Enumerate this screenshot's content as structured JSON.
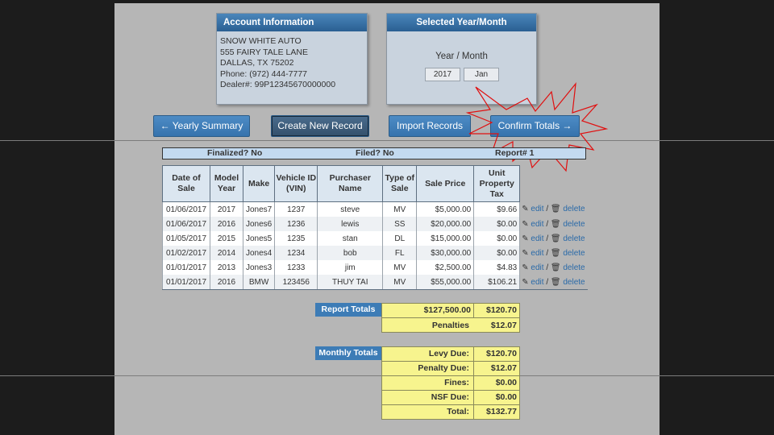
{
  "account_panel": {
    "title": "Account Information",
    "lines": [
      "SNOW WHITE AUTO",
      "555 FAIRY TALE LANE",
      "DALLAS, TX 75202",
      "Phone: (972) 444-7777",
      "Dealer#: 99P12345670000000"
    ]
  },
  "year_month_panel": {
    "title": "Selected Year/Month",
    "label": "Year / Month",
    "year": "2017",
    "month": "Jan"
  },
  "toolbar": {
    "yearly_summary": "← Yearly Summary",
    "create_record": "Create New Record",
    "import_records": "Import Records",
    "confirm_totals": "Confirm Totals →"
  },
  "status": {
    "finalized": "Finalized? No",
    "filed": "Filed? No",
    "report": "Report# 1"
  },
  "table": {
    "headers": [
      "Date of Sale",
      "Model Year",
      "Make",
      "Vehicle ID (VIN)",
      "Purchaser Name",
      "Type of Sale",
      "Sale Price",
      "Unit Property Tax"
    ],
    "action_edit": "edit",
    "action_sep": "/",
    "action_delete": "delete",
    "rows": [
      [
        "01/06/2017",
        "2017",
        "Jones7",
        "1237",
        "steve",
        "MV",
        "$5,000.00",
        "$9.66"
      ],
      [
        "01/06/2017",
        "2016",
        "Jones6",
        "1236",
        "lewis",
        "SS",
        "$20,000.00",
        "$0.00"
      ],
      [
        "01/05/2017",
        "2015",
        "Jones5",
        "1235",
        "stan",
        "DL",
        "$15,000.00",
        "$0.00"
      ],
      [
        "01/02/2017",
        "2014",
        "Jones4",
        "1234",
        "bob",
        "FL",
        "$30,000.00",
        "$0.00"
      ],
      [
        "01/01/2017",
        "2013",
        "Jones3",
        "1233",
        "jim",
        "MV",
        "$2,500.00",
        "$4.83"
      ],
      [
        "01/01/2017",
        "2016",
        "BMW",
        "123456",
        "THUY TAI",
        "MV",
        "$55,000.00",
        "$106.21"
      ]
    ]
  },
  "report_totals": {
    "label": "Report Totals",
    "sale_total": "$127,500.00",
    "tax_total": "$120.70",
    "penalties_label": "Penalties",
    "penalties_value": "$12.07"
  },
  "monthly_totals": {
    "label": "Monthly Totals",
    "items": [
      {
        "label": "Levy Due:",
        "value": "$120.70"
      },
      {
        "label": "Penalty Due:",
        "value": "$12.07"
      },
      {
        "label": "Fines:",
        "value": "$0.00"
      },
      {
        "label": "NSF Due:",
        "value": "$0.00"
      },
      {
        "label": "Total:",
        "value": "$132.77"
      }
    ]
  },
  "colors": {
    "header_blue": "#3d7cb6",
    "totals_yellow": "#f7f48e",
    "star_outline": "#e01010"
  },
  "icons": {
    "edit": "pencil-icon",
    "delete": "trash-icon"
  }
}
